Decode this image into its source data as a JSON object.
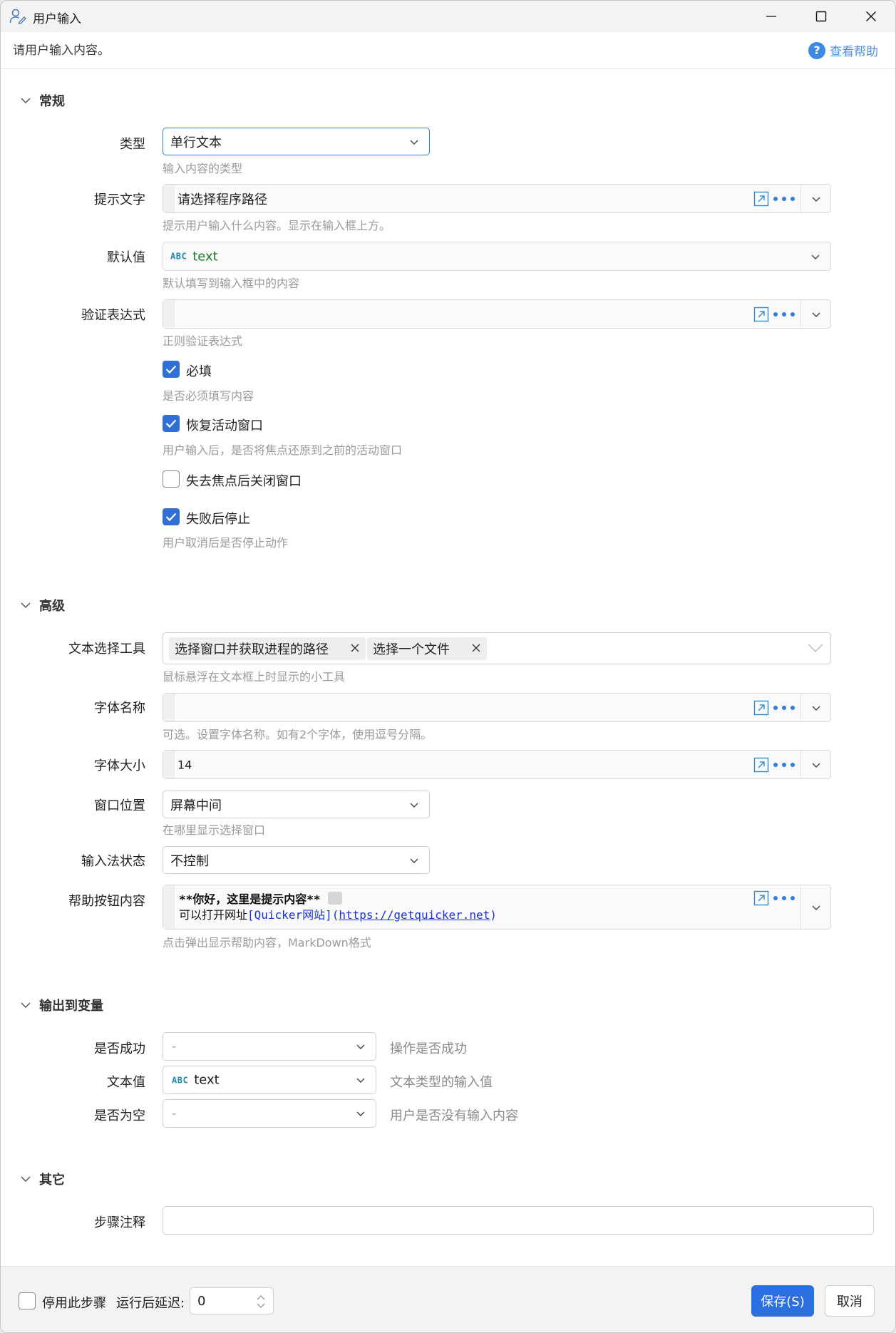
{
  "window": {
    "title": "用户输入",
    "description": "请用户输入内容。",
    "help_link": "查看帮助"
  },
  "sections": {
    "general": "常规",
    "advanced": "高级",
    "output": "输出到变量",
    "other": "其它"
  },
  "general": {
    "type": {
      "label": "类型",
      "value": "单行文本",
      "hint": "输入内容的类型"
    },
    "prompt": {
      "label": "提示文字",
      "value": "请选择程序路径",
      "hint": "提示用户输入什么内容。显示在输入框上方。"
    },
    "default": {
      "label": "默认值",
      "badge": "ABC",
      "value": "text",
      "hint": "默认填写到输入框中的内容"
    },
    "validation": {
      "label": "验证表达式",
      "value": "",
      "hint": "正则验证表达式"
    },
    "required": {
      "label": "必填",
      "checked": true,
      "hint": "是否必须填写内容"
    },
    "restore_window": {
      "label": "恢复活动窗口",
      "checked": true,
      "hint": "用户输入后，是否将焦点还原到之前的活动窗口"
    },
    "close_on_blur": {
      "label": "失去焦点后关闭窗口",
      "checked": false
    },
    "stop_on_fail": {
      "label": "失败后停止",
      "checked": true,
      "hint": "用户取消后是否停止动作"
    }
  },
  "advanced": {
    "text_tools": {
      "label": "文本选择工具",
      "tags": [
        "选择窗口并获取进程的路径",
        "选择一个文件"
      ],
      "hint": "鼠标悬浮在文本框上时显示的小工具"
    },
    "font_name": {
      "label": "字体名称",
      "value": "",
      "hint": "可选。设置字体名称。如有2个字体，使用逗号分隔。"
    },
    "font_size": {
      "label": "字体大小",
      "value": "14"
    },
    "window_pos": {
      "label": "窗口位置",
      "value": "屏幕中间",
      "hint": "在哪里显示选择窗口"
    },
    "ime_state": {
      "label": "输入法状态",
      "value": "不控制"
    },
    "help_content": {
      "label": "帮助按钮内容",
      "line1": "**你好，这里是提示内容**",
      "line2_prefix": "可以打开网址",
      "line2_link": "[Quicker网站]",
      "line2_open": "(",
      "line2_url": "https://getquicker.net",
      "line2_close": ")",
      "hint": "点击弹出显示帮助内容，MarkDown格式"
    }
  },
  "output": {
    "success": {
      "label": "是否成功",
      "value": "-",
      "hint": "操作是否成功"
    },
    "text": {
      "label": "文本值",
      "badge": "ABC",
      "value": "text",
      "hint": "文本类型的输入值"
    },
    "empty": {
      "label": "是否为空",
      "value": "-",
      "hint": "用户是否没有输入内容"
    }
  },
  "other": {
    "note": {
      "label": "步骤注释",
      "value": ""
    }
  },
  "footer": {
    "disable_label": "停用此步骤",
    "delay_label": "运行后延迟:",
    "delay_value": "0",
    "save": "保存(S)",
    "cancel": "取消"
  },
  "colors": {
    "accent": "#2b6fe0",
    "link": "#4a90e2",
    "hint": "#9a9a9a"
  }
}
